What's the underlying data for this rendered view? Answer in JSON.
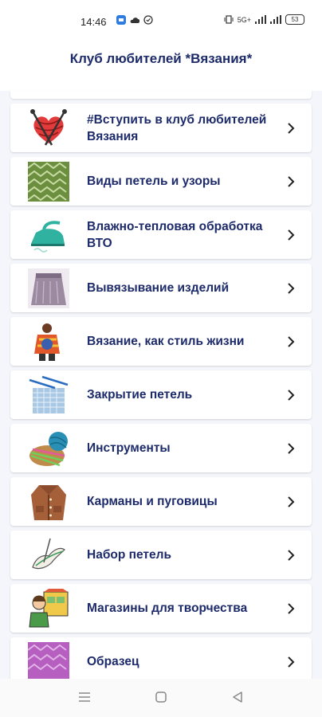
{
  "status": {
    "time": "14:46",
    "battery": "53",
    "network": "5G+"
  },
  "header": {
    "title": "Клуб любителей *Вязания*"
  },
  "items": [
    {
      "label": "#Вступить в клуб любителей Вязания",
      "icon": "yarn-heart-icon"
    },
    {
      "label": "Виды петель и узоры",
      "icon": "knit-pattern-icon"
    },
    {
      "label": "Влажно-тепловая обработка ВТО",
      "icon": "steam-iron-icon"
    },
    {
      "label": "Вывязывание изделий",
      "icon": "knit-skirt-icon"
    },
    {
      "label": "Вязание, как стиль жизни",
      "icon": "knit-woman-icon"
    },
    {
      "label": "Закрытие петель",
      "icon": "binding-off-icon"
    },
    {
      "label": "Инструменты",
      "icon": "yarn-tools-icon"
    },
    {
      "label": "Карманы и пуговицы",
      "icon": "cardigan-icon"
    },
    {
      "label": "Набор петель",
      "icon": "casting-on-icon"
    },
    {
      "label": "Магазины для творчества",
      "icon": "craft-shop-icon"
    },
    {
      "label": "Образец",
      "icon": "knit-sample-icon"
    }
  ],
  "colors": {
    "title": "#1d2b6b",
    "background": "#f4f6fb"
  }
}
